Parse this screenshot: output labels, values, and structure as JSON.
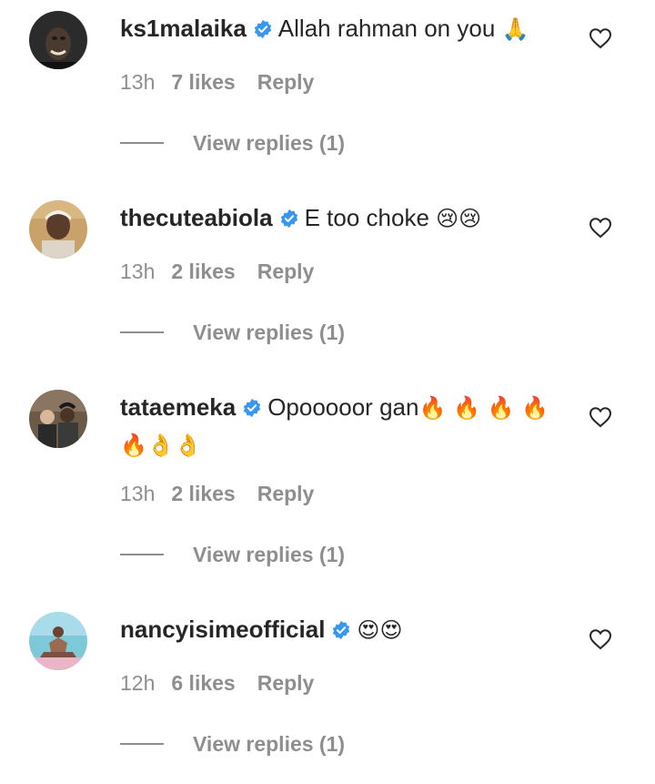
{
  "comments": [
    {
      "username": "ks1malaika",
      "text": "Allah rahman on you",
      "emoji": "🙏",
      "time": "13h",
      "likes": "7 likes",
      "reply": "Reply",
      "view_replies": "View replies (1)"
    },
    {
      "username": "thecuteabiola",
      "text": "E too choke",
      "emoji": "😢😢",
      "time": "13h",
      "likes": "2 likes",
      "reply": "Reply",
      "view_replies": "View replies (1)"
    },
    {
      "username": "tataemeka",
      "text": "Opooooor gan",
      "emoji": "🔥 🔥 🔥 🔥",
      "emoji2": "🔥👌👌",
      "time": "13h",
      "likes": "2 likes",
      "reply": "Reply",
      "view_replies": "View replies (1)"
    },
    {
      "username": "nancyisimeofficial",
      "text": "",
      "emoji": "😍😍",
      "time": "12h",
      "likes": "6 likes",
      "reply": "Reply",
      "view_replies": "View replies (1)"
    }
  ],
  "colors": {
    "text": "#262626",
    "secondary": "#8e8e8e",
    "verified": "#3897f0"
  },
  "icons": {
    "verified": "verified-badge-icon",
    "like": "heart-outline-icon"
  }
}
